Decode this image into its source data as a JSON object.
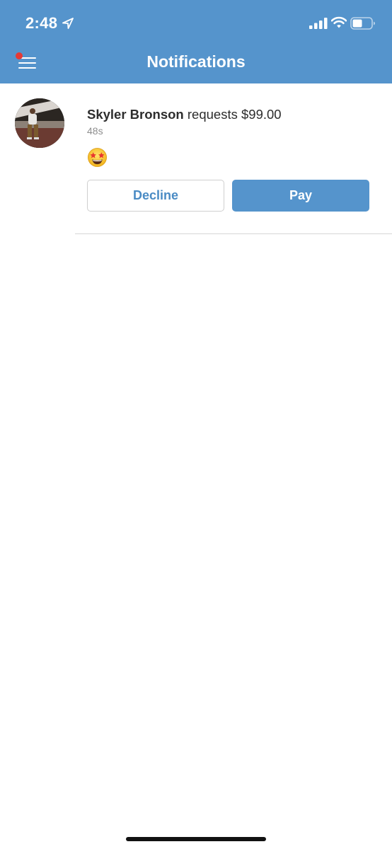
{
  "status_bar": {
    "time": "2:48",
    "icons": [
      "location-arrow-icon",
      "cellular-signal-icon",
      "wifi-icon",
      "battery-icon"
    ]
  },
  "header": {
    "title": "Notifications",
    "menu_icon": "hamburger-menu-icon",
    "has_badge": true
  },
  "notifications": [
    {
      "name": "Skyler Bronson",
      "action": " requests $99.00",
      "time": "48s",
      "emoji": "star-struck-emoji",
      "decline_label": "Decline",
      "pay_label": "Pay"
    }
  ],
  "colors": {
    "brand_blue": "#5594cc",
    "badge_red": "#e53935",
    "text_dark": "#2d2d2d",
    "text_muted": "#8e8e8e"
  }
}
